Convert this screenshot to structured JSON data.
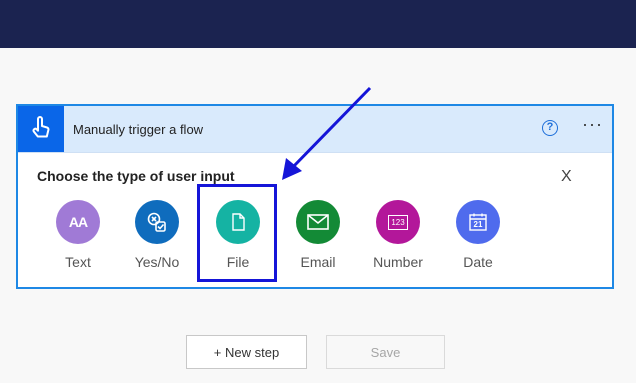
{
  "trigger": {
    "title": "Manually trigger a flow",
    "help_symbol": "?",
    "more_symbol": "···",
    "prompt": "Choose the type of user input",
    "close_symbol": "X"
  },
  "input_types": [
    {
      "label": "Text",
      "color": "#a07ad6",
      "icon": "text-icon"
    },
    {
      "label": "Yes/No",
      "color": "#0f6cbd",
      "icon": "yes-no-icon"
    },
    {
      "label": "File",
      "color": "#15b3a3",
      "icon": "file-icon"
    },
    {
      "label": "Email",
      "color": "#138a36",
      "icon": "email-icon"
    },
    {
      "label": "Number",
      "color": "#b3179a",
      "icon": "number-icon"
    },
    {
      "label": "Date",
      "color": "#4f6bed",
      "icon": "date-icon"
    }
  ],
  "icon_text": {
    "text_glyph": "AA",
    "number_glyph": "123",
    "date_glyph": "21"
  },
  "actions": {
    "new_step": "+ New step",
    "save": "Save"
  },
  "colors": {
    "topbar": "#1b2350",
    "accent": "#0a66e8",
    "annotation": "#1515d8"
  }
}
